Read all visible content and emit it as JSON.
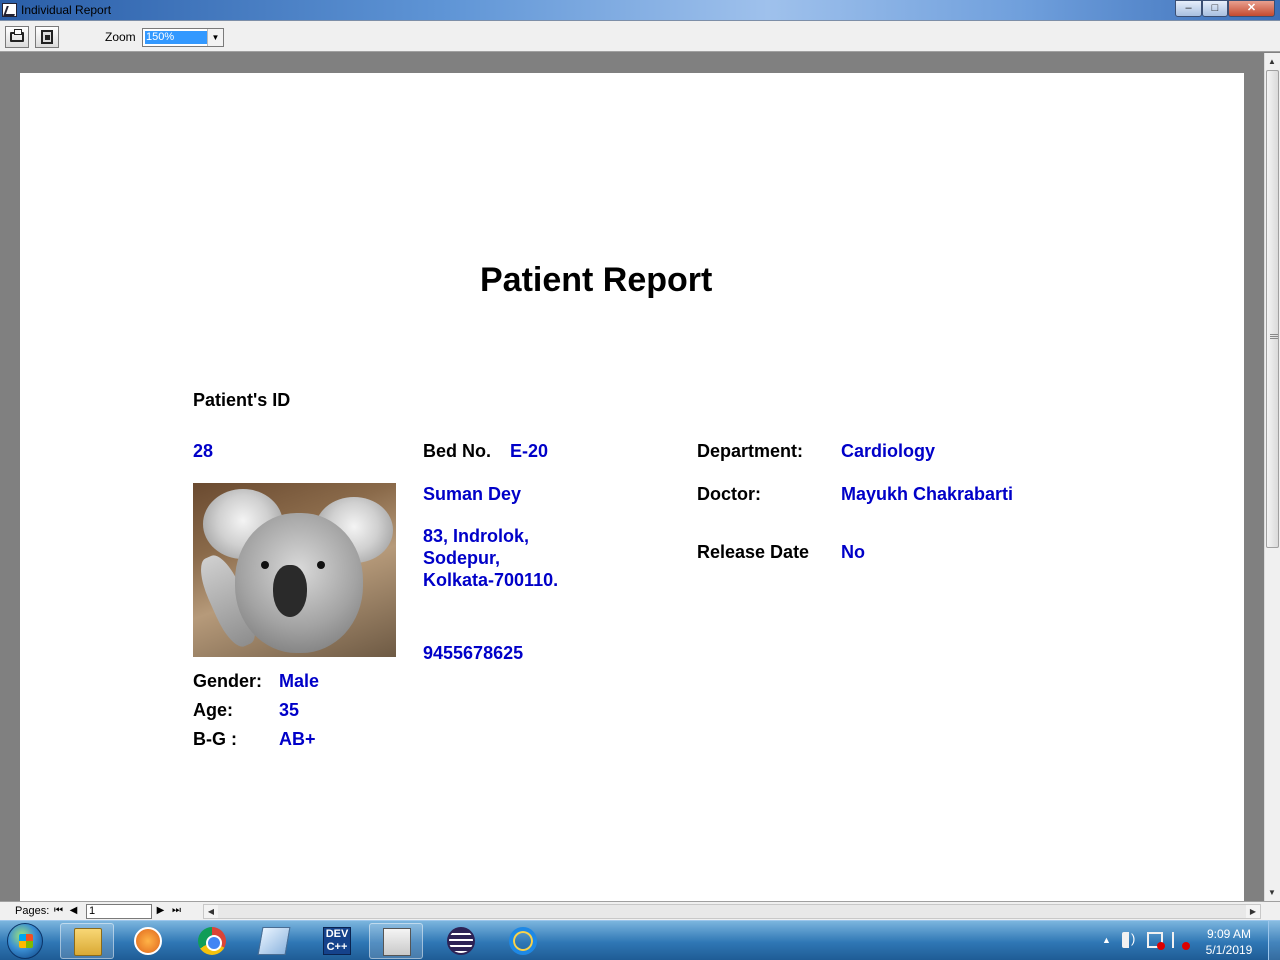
{
  "window": {
    "title": "Individual Report",
    "minimize_glyph": "–",
    "maximize_glyph": "□",
    "close_glyph": "✕"
  },
  "toolbar": {
    "zoom_label": "Zoom",
    "zoom_value": "150%"
  },
  "report": {
    "title": "Patient Report",
    "patient_id_label": "Patient's ID",
    "patient_id": "28",
    "bed_label": "Bed No.",
    "bed_value": "E-20",
    "name": "Suman Dey",
    "address_line1": "83, Indrolok,",
    "address_line2": "Sodepur,",
    "address_line3": "Kolkata-700110.",
    "phone": "9455678625",
    "department_label": "Department:",
    "department_value": "Cardiology",
    "doctor_label": "Doctor:",
    "doctor_value": "Mayukh Chakrabarti",
    "release_label": "Release Date",
    "release_value": "No",
    "gender_label": "Gender:",
    "gender_value": "Male",
    "age_label": "Age:",
    "age_value": "35",
    "blood_group_label": "B-G :",
    "blood_group_value": "AB+"
  },
  "navigation": {
    "pages_label": "Pages:",
    "current_page": "1"
  },
  "taskbar": {
    "time": "9:09 AM",
    "date": "5/1/2019",
    "devcpp_label": "DEV C++"
  },
  "icons": {
    "start": "windows-start-icon",
    "explorer": "file-explorer-icon",
    "media": "media-player-icon",
    "chrome": "chrome-icon",
    "notes": "sticky-notes-icon",
    "devcpp": "dev-cpp-icon",
    "project": "project-icon",
    "eclipse": "eclipse-icon",
    "ie": "internet-explorer-icon"
  }
}
